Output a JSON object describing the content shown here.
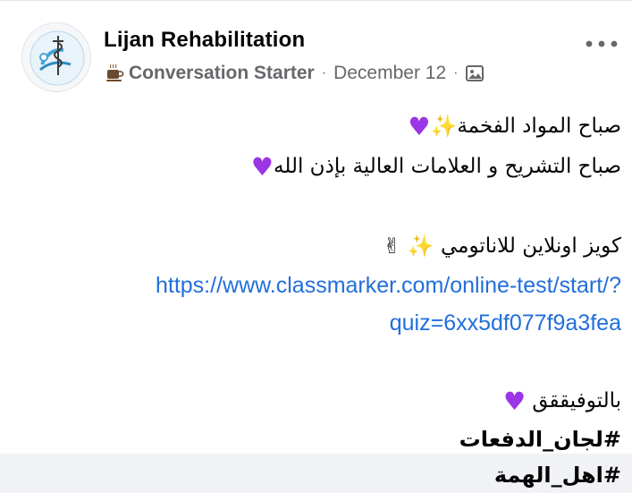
{
  "post": {
    "page_name": "Lijan Rehabilitation",
    "badge_label": "Conversation Starter",
    "separator": "·",
    "date": "December 12",
    "lines": {
      "greeting_1": "صباح المواد الفخمة",
      "greeting_2": "صباح التشريح و العلامات العالية بإذن الله",
      "quiz_intro": "كويز اونلاين للاناتومي",
      "link_part_1": "https://www.classmarker.com/online-test/start/?",
      "link_part_2": "quiz=6xx5df077f9a3fea",
      "good_luck": "بالتوفيققق",
      "hashtag_1": "#لجان_الدفعات",
      "hashtag_2": "#اهل_الهمة"
    },
    "icons": {
      "badge": "coffee-cup-icon",
      "audience": "photo-album-icon",
      "more": "more-horizontal-icon",
      "heart": "purple-heart-emoji",
      "sparkles": "sparkles-emoji",
      "victory": "victory-hand-emoji"
    },
    "colors": {
      "link": "#216fdb",
      "meta": "#65676b",
      "text": "#050505",
      "heart": "#9b35e6"
    }
  }
}
